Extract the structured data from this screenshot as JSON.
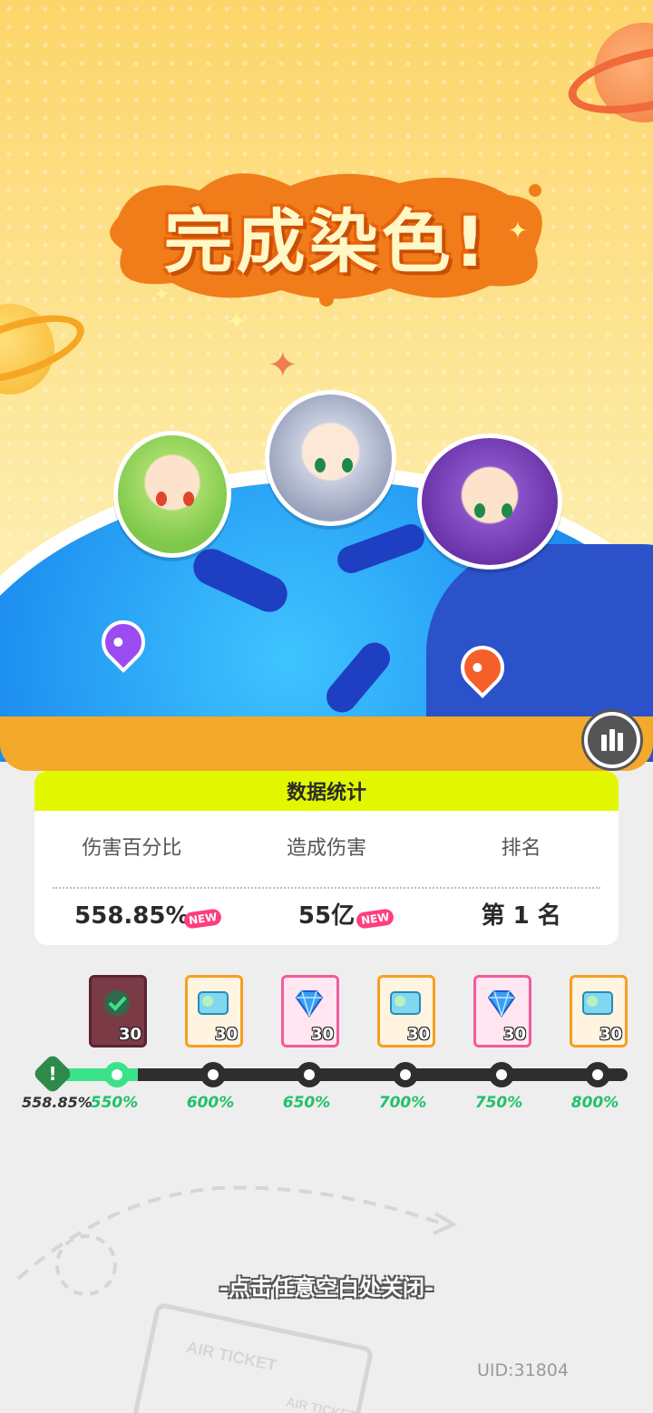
{
  "hero": {
    "title": "完成染色!"
  },
  "stats": {
    "title": "数据统计",
    "new_badge": "NEW",
    "columns": [
      {
        "label": "伤害百分比",
        "value": "558.85%",
        "is_new": true
      },
      {
        "label": "造成伤害",
        "value": "55亿",
        "is_new": true
      },
      {
        "label": "排名",
        "value": "第 1 名",
        "is_new": false
      }
    ]
  },
  "rewards": [
    {
      "icon": "claimed-check-icon",
      "count": "30",
      "claimed": true
    },
    {
      "icon": "ticket-icon",
      "count": "30",
      "claimed": false
    },
    {
      "icon": "blue-gem-icon",
      "count": "30",
      "claimed": false
    },
    {
      "icon": "ticket-icon",
      "count": "30",
      "claimed": false
    },
    {
      "icon": "blue-gem-icon",
      "count": "30",
      "claimed": false
    },
    {
      "icon": "ticket-icon",
      "count": "30",
      "claimed": false
    }
  ],
  "progress": {
    "current": "558.85%",
    "current_value": 558.85,
    "milestones": [
      "550%",
      "600%",
      "650%",
      "700%",
      "750%",
      "800%"
    ]
  },
  "close_hint": "-点击任意空白处关闭-",
  "uid": "UID:31804",
  "colors": {
    "stats_header": "#e3f800",
    "progress_fill": "#3ce28a",
    "milestone_text": "#22c06a",
    "title_splash": "#f07d1a",
    "globe": "#1d8ef0"
  }
}
